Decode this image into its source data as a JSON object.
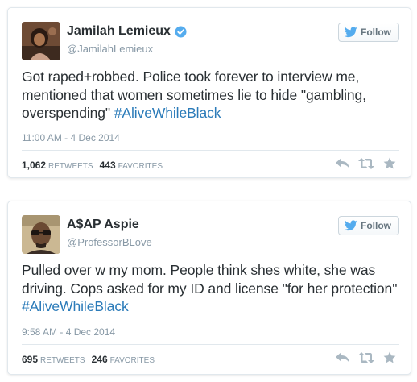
{
  "tweets": [
    {
      "display_name": "Jamilah Lemieux",
      "screen_name": "@JamilahLemieux",
      "verified": true,
      "follow_label": "Follow",
      "text_plain": "Got raped+robbed. Police took forever to interview me, mentioned that women sometimes lie to hide \"gambling, overspending\" ",
      "hashtag": "#AliveWhileBlack",
      "timestamp": "11:00 AM - 4 Dec 2014",
      "retweets": "1,062",
      "retweets_label": "RETWEETS",
      "favorites": "443",
      "favorites_label": "FAVORITES"
    },
    {
      "display_name": "A$AP Aspie",
      "screen_name": "@ProfessorBLove",
      "verified": false,
      "follow_label": "Follow",
      "text_plain": "Pulled over w my mom. People think shes white, she was driving. Cops asked for my ID and license \"for her protection\" ",
      "hashtag": "#AliveWhileBlack",
      "timestamp": "9:58 AM - 4 Dec 2014",
      "retweets": "695",
      "retweets_label": "RETWEETS",
      "favorites": "246",
      "favorites_label": "FAVORITES"
    }
  ],
  "icons": {
    "bird": "twitter-bird-icon",
    "verified": "verified-badge-icon",
    "reply": "reply-icon",
    "retweet": "retweet-icon",
    "favorite": "star-icon"
  },
  "colors": {
    "link": "#2b7bb9",
    "muted": "#8899a6",
    "verified": "#55acee",
    "bird": "#55acee",
    "action": "#aab8c2"
  }
}
